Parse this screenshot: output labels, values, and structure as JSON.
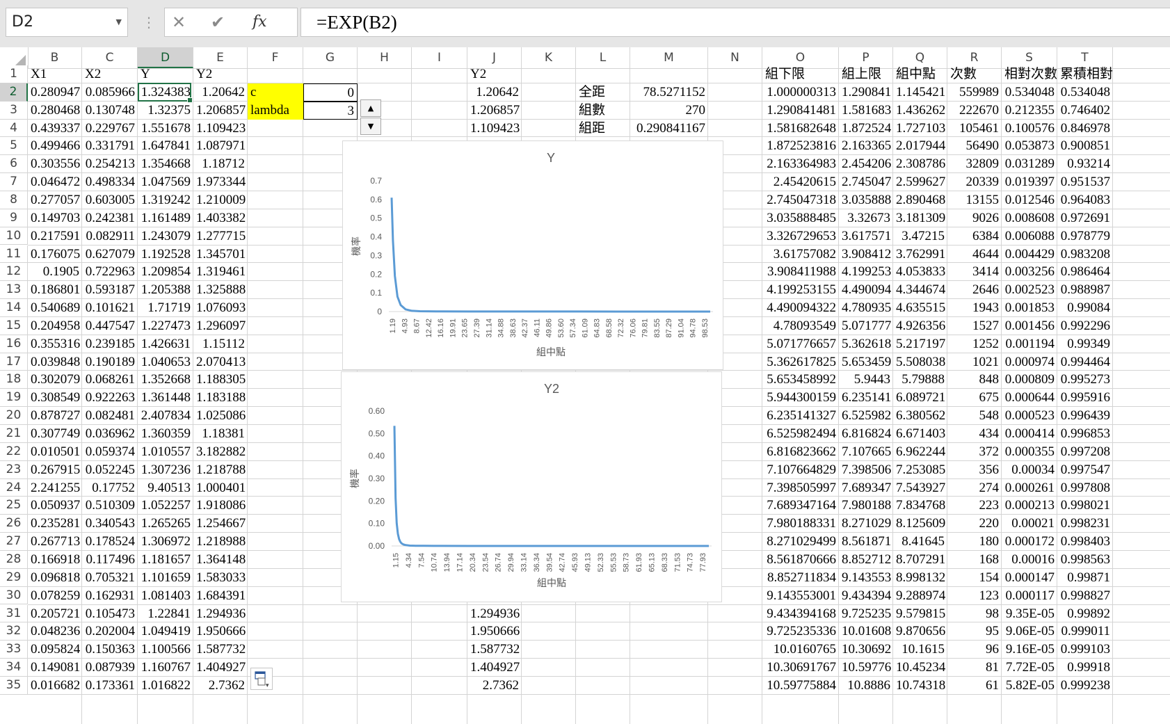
{
  "namebox": {
    "value": "D2"
  },
  "formula": {
    "value": "=EXP(B2)",
    "cancel": "✕",
    "enter": "✔",
    "fx": "fx"
  },
  "columns": [
    "B",
    "C",
    "D",
    "E",
    "F",
    "G",
    "H",
    "I",
    "J",
    "K",
    "L",
    "M",
    "N",
    "O",
    "P",
    "Q",
    "R",
    "S",
    "T"
  ],
  "selected_column": "D",
  "selected_row": 2,
  "rows": [
    1,
    2,
    3,
    4,
    5,
    6,
    7,
    8,
    9,
    10,
    11,
    12,
    13,
    14,
    15,
    16,
    17,
    18,
    19,
    20,
    21,
    22,
    23,
    24,
    25,
    26,
    27,
    28,
    29,
    30,
    31,
    32,
    33,
    34,
    35
  ],
  "headers": {
    "B": "X1",
    "C": "X2",
    "D": "Y",
    "E": "Y2",
    "J": "Y2",
    "O": "組下限",
    "P": "組上限",
    "Q": "組中點",
    "R": "次數",
    "S": "相對次數",
    "T": "累積相對次"
  },
  "params": [
    {
      "label": "c",
      "value": "0"
    },
    {
      "label": "lambda",
      "value": "3"
    }
  ],
  "stats": [
    {
      "label": "全距",
      "value": "78.5271152"
    },
    {
      "label": "組數",
      "value": "270"
    },
    {
      "label": "組距",
      "value": "0.290841167"
    }
  ],
  "spinner": {
    "up": "▲",
    "down": "▼"
  },
  "colB": [
    "0.280947",
    "0.280468",
    "0.439337",
    "0.499466",
    "0.303556",
    "0.046472",
    "0.277057",
    "0.149703",
    "0.217591",
    "0.176075",
    "0.1905",
    "0.186801",
    "0.540689",
    "0.204958",
    "0.355316",
    "0.039848",
    "0.302079",
    "0.308549",
    "0.878727",
    "0.307749",
    "0.010501",
    "0.267915",
    "2.241255",
    "0.050937",
    "0.235281",
    "0.267713",
    "0.166918",
    "0.096818",
    "0.078259",
    "0.205721",
    "0.048236",
    "0.095824",
    "0.149081",
    "0.016682"
  ],
  "colC": [
    "0.085966",
    "0.130748",
    "0.229767",
    "0.331791",
    "0.254213",
    "0.498334",
    "0.603005",
    "0.242381",
    "0.082911",
    "0.627079",
    "0.722963",
    "0.593187",
    "0.101621",
    "0.447547",
    "0.239185",
    "0.190189",
    "0.068261",
    "0.922263",
    "0.082481",
    "0.036962",
    "0.059374",
    "0.052245",
    "0.17752",
    "0.510309",
    "0.340543",
    "0.178524",
    "0.117496",
    "0.705321",
    "0.162931",
    "0.105473",
    "0.202004",
    "0.150363",
    "0.087939",
    "0.173361"
  ],
  "colD": [
    "1.324383",
    "1.32375",
    "1.551678",
    "1.647841",
    "1.354668",
    "1.047569",
    "1.319242",
    "1.161489",
    "1.243079",
    "1.192528",
    "1.209854",
    "1.205388",
    "1.71719",
    "1.227473",
    "1.426631",
    "1.040653",
    "1.352668",
    "1.361448",
    "2.407834",
    "1.360359",
    "1.010557",
    "1.307236",
    "9.40513",
    "1.052257",
    "1.265265",
    "1.306972",
    "1.181657",
    "1.101659",
    "1.081403",
    "1.22841",
    "1.049419",
    "1.100566",
    "1.160767",
    "1.016822"
  ],
  "colE": [
    "1.20642",
    "1.206857",
    "1.109423",
    "1.087971",
    "1.18712",
    "1.973344",
    "1.210009",
    "1.403382",
    "1.277715",
    "1.345701",
    "1.319461",
    "1.325888",
    "1.076093",
    "1.296097",
    "1.15112",
    "2.070413",
    "1.188305",
    "1.183188",
    "1.025086",
    "1.18381",
    "3.182882",
    "1.218788",
    "1.000401",
    "1.918086",
    "1.254667",
    "1.218988",
    "1.364148",
    "1.583033",
    "1.684391",
    "1.294936",
    "1.950666",
    "1.587732",
    "1.404927",
    "2.7362"
  ],
  "colJ_top": [
    "1.20642",
    "1.206857",
    "1.109423"
  ],
  "colJ_bottom": [
    "1.294936",
    "1.950666",
    "1.587732",
    "1.404927",
    "2.7362"
  ],
  "colO": [
    "1.000000313",
    "1.290841481",
    "1.581682648",
    "1.872523816",
    "2.163364983",
    "2.45420615",
    "2.745047318",
    "3.035888485",
    "3.326729653",
    "3.61757082",
    "3.908411988",
    "4.199253155",
    "4.490094322",
    "4.78093549",
    "5.071776657",
    "5.362617825",
    "5.653458992",
    "5.944300159",
    "6.235141327",
    "6.525982494",
    "6.816823662",
    "7.107664829",
    "7.398505997",
    "7.689347164",
    "7.980188331",
    "8.271029499",
    "8.561870666",
    "8.852711834",
    "9.143553001",
    "9.434394168",
    "9.725235336",
    "10.0160765",
    "10.30691767",
    "10.59775884"
  ],
  "colP": [
    "1.290841",
    "1.581683",
    "1.872524",
    "2.163365",
    "2.454206",
    "2.745047",
    "3.035888",
    "3.32673",
    "3.617571",
    "3.908412",
    "4.199253",
    "4.490094",
    "4.780935",
    "5.071777",
    "5.362618",
    "5.653459",
    "5.9443",
    "6.235141",
    "6.525982",
    "6.816824",
    "7.107665",
    "7.398506",
    "7.689347",
    "7.980188",
    "8.271029",
    "8.561871",
    "8.852712",
    "9.143553",
    "9.434394",
    "9.725235",
    "10.01608",
    "10.30692",
    "10.59776",
    "10.8886"
  ],
  "colQ": [
    "1.145421",
    "1.436262",
    "1.727103",
    "2.017944",
    "2.308786",
    "2.599627",
    "2.890468",
    "3.181309",
    "3.47215",
    "3.762991",
    "4.053833",
    "4.344674",
    "4.635515",
    "4.926356",
    "5.217197",
    "5.508038",
    "5.79888",
    "6.089721",
    "6.380562",
    "6.671403",
    "6.962244",
    "7.253085",
    "7.543927",
    "7.834768",
    "8.125609",
    "8.41645",
    "8.707291",
    "8.998132",
    "9.288974",
    "9.579815",
    "9.870656",
    "10.1615",
    "10.45234",
    "10.74318"
  ],
  "colR": [
    "559989",
    "222670",
    "105461",
    "56490",
    "32809",
    "20339",
    "13155",
    "9026",
    "6384",
    "4644",
    "3414",
    "2646",
    "1943",
    "1527",
    "1252",
    "1021",
    "848",
    "675",
    "548",
    "434",
    "372",
    "356",
    "274",
    "223",
    "220",
    "180",
    "168",
    "154",
    "123",
    "98",
    "95",
    "96",
    "81",
    "61"
  ],
  "colS": [
    "0.534048",
    "0.212355",
    "0.100576",
    "0.053873",
    "0.031289",
    "0.019397",
    "0.012546",
    "0.008608",
    "0.006088",
    "0.004429",
    "0.003256",
    "0.002523",
    "0.001853",
    "0.001456",
    "0.001194",
    "0.000974",
    "0.000809",
    "0.000644",
    "0.000523",
    "0.000414",
    "0.000355",
    "0.00034",
    "0.000261",
    "0.000213",
    "0.00021",
    "0.000172",
    "0.00016",
    "0.000147",
    "0.000117",
    "9.35E-05",
    "9.06E-05",
    "9.16E-05",
    "7.72E-05",
    "5.82E-05"
  ],
  "colT": [
    "0.534048",
    "0.746402",
    "0.846978",
    "0.900851",
    "0.93214",
    "0.951537",
    "0.964083",
    "0.972691",
    "0.978779",
    "0.983208",
    "0.986464",
    "0.988987",
    "0.99084",
    "0.992296",
    "0.99349",
    "0.994464",
    "0.995273",
    "0.995916",
    "0.996439",
    "0.996853",
    "0.997208",
    "0.997547",
    "0.997808",
    "0.998021",
    "0.998231",
    "0.998403",
    "0.998563",
    "0.99871",
    "0.998827",
    "0.99892",
    "0.999011",
    "0.999103",
    "0.99918",
    "0.999238"
  ],
  "chart_data": [
    {
      "type": "line",
      "title": "Y",
      "xlabel": "組中點",
      "ylabel": "機率",
      "color": "#5b9bd5",
      "ylim": [
        0,
        0.7
      ],
      "yticks": [
        "0",
        "0.1",
        "0.2",
        "0.3",
        "0.4",
        "0.5",
        "0.6",
        "0.7"
      ],
      "xticks": [
        "1.19",
        "4.93",
        "8.67",
        "12.42",
        "16.16",
        "19.91",
        "23.65",
        "27.39",
        "31.14",
        "34.88",
        "38.63",
        "42.37",
        "46.11",
        "49.86",
        "53.60",
        "57.34",
        "61.09",
        "64.83",
        "68.58",
        "72.32",
        "76.06",
        "79.81",
        "83.55",
        "87.29",
        "91.04",
        "94.78",
        "98.53"
      ],
      "xlim": [
        1.19,
        100
      ],
      "x": [
        1.19,
        1.6,
        2.2,
        3.0,
        4.0,
        5.5,
        7.5,
        10,
        15,
        25,
        40,
        60,
        80,
        100
      ],
      "y": [
        0.61,
        0.38,
        0.19,
        0.08,
        0.035,
        0.012,
        0.004,
        0.002,
        0.001,
        0.0005,
        0.0003,
        0.0002,
        0.0001,
        0.0001
      ]
    },
    {
      "type": "line",
      "title": "Y2",
      "xlabel": "組中點",
      "ylabel": "機率",
      "color": "#5b9bd5",
      "ylim": [
        0,
        0.6
      ],
      "yticks": [
        "0.00",
        "0.10",
        "0.20",
        "0.30",
        "0.40",
        "0.50",
        "0.60"
      ],
      "xticks": [
        "1.15",
        "4.34",
        "7.54",
        "10.74",
        "13.94",
        "17.14",
        "20.34",
        "23.54",
        "26.74",
        "29.94",
        "33.14",
        "36.34",
        "39.54",
        "42.74",
        "45.93",
        "49.13",
        "52.33",
        "55.53",
        "58.73",
        "61.93",
        "65.13",
        "68.33",
        "71.53",
        "74.73",
        "77.93"
      ],
      "xlim": [
        1.15,
        79.5
      ],
      "x": [
        1.15,
        1.45,
        1.73,
        2.02,
        2.31,
        2.6,
        2.89,
        3.18,
        3.47,
        4.0,
        5.0,
        6.5,
        8.5,
        11,
        20,
        40,
        60,
        79.5
      ],
      "y": [
        0.534,
        0.212,
        0.101,
        0.054,
        0.031,
        0.019,
        0.0125,
        0.0086,
        0.0061,
        0.0037,
        0.0017,
        0.0009,
        0.0005,
        0.0003,
        0.0001,
        0.0001,
        0.0001,
        0.0001
      ]
    }
  ]
}
